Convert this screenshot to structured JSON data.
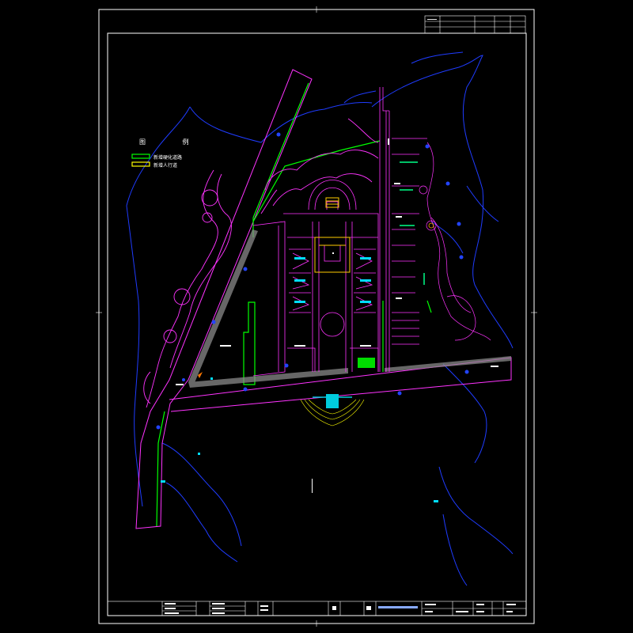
{
  "drawing": {
    "legend": {
      "title": "图 例",
      "items": [
        {
          "label": "新增硬化道路",
          "color": "#00ff00"
        },
        {
          "label": "新增人行道",
          "color": "#ffff00"
        }
      ]
    },
    "title_block": {
      "labels": [
        "审定人",
        "审核人",
        "校核人",
        "设计人",
        "制图人",
        "专业",
        "图号",
        "日期"
      ]
    }
  }
}
